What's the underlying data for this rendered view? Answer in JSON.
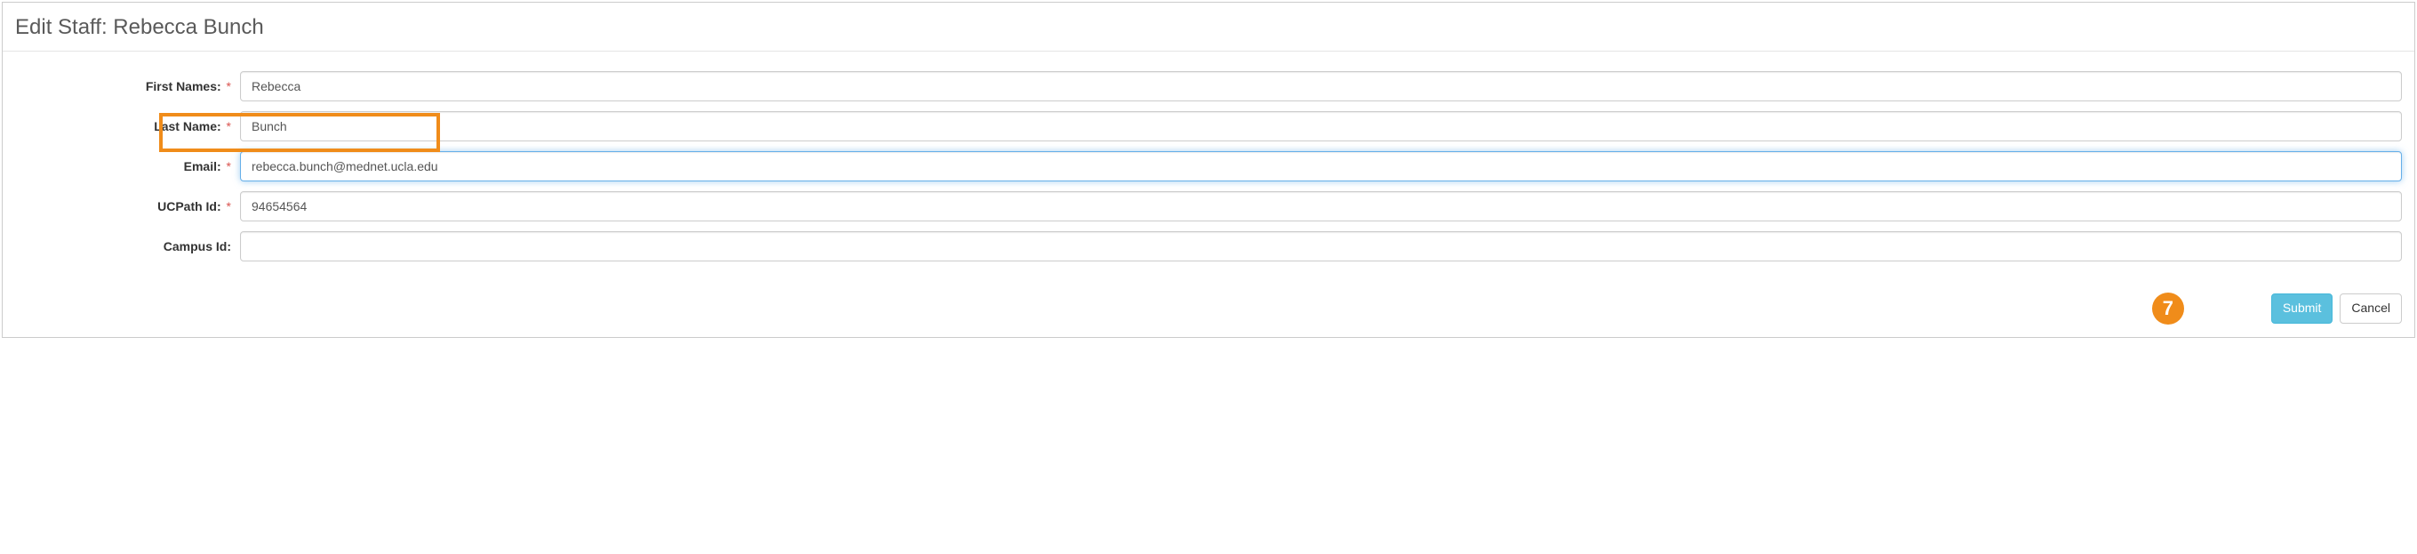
{
  "header": {
    "title": "Edit Staff: Rebecca Bunch"
  },
  "form": {
    "firstNames": {
      "label": "First Names:",
      "required": "*",
      "value": "Rebecca"
    },
    "lastName": {
      "label": "Last Name:",
      "required": "*",
      "value": "Bunch"
    },
    "email": {
      "label": "Email:",
      "required": "*",
      "value": "rebecca.bunch@mednet.ucla.edu"
    },
    "ucpathId": {
      "label": "UCPath Id:",
      "required": "*",
      "value": "94654564"
    },
    "campusId": {
      "label": "Campus Id:",
      "value": ""
    }
  },
  "footer": {
    "submit": "Submit",
    "cancel": "Cancel"
  },
  "annotation": {
    "badge": "7"
  }
}
